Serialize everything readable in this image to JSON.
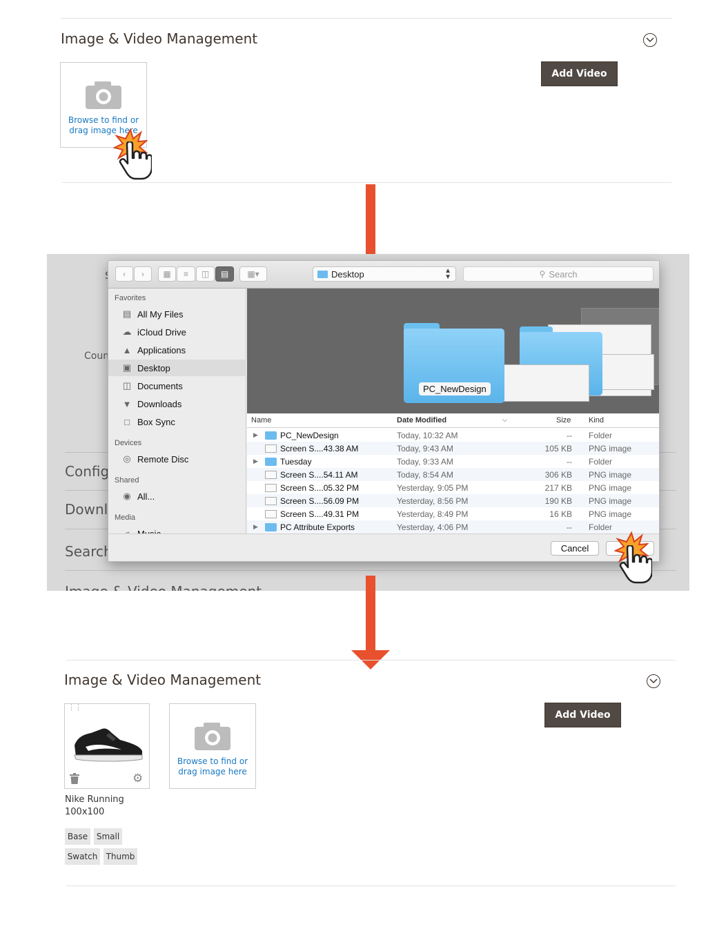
{
  "top_panel": {
    "title": "Image & Video Management",
    "add_video_label": "Add Video",
    "browse_text_1": "Browse to find or",
    "browse_text_2": "drag image here"
  },
  "file_dialog": {
    "location": "Desktop",
    "search_placeholder": "Search",
    "background_labels": [
      "S",
      "Coun",
      "Config",
      "Downl",
      "Search",
      "Image & Video Management"
    ],
    "sidebar": {
      "favorites_header": "Favorites",
      "favorites": [
        "All My Files",
        "iCloud Drive",
        "Applications",
        "Desktop",
        "Documents",
        "Downloads",
        "Box Sync"
      ],
      "devices_header": "Devices",
      "devices": [
        "Remote Disc"
      ],
      "shared_header": "Shared",
      "shared": [
        "All..."
      ],
      "media_header": "Media",
      "media": [
        "Music"
      ]
    },
    "preview_folder_label": "PC_NewDesign",
    "columns": {
      "name": "Name",
      "date": "Date Modified",
      "size": "Size",
      "kind": "Kind"
    },
    "files": [
      {
        "name": "PC_NewDesign",
        "date": "Today, 10:32 AM",
        "size": "--",
        "kind": "Folder",
        "type": "folder"
      },
      {
        "name": "Screen S....43.38 AM",
        "date": "Today, 9:43 AM",
        "size": "105 KB",
        "kind": "PNG image",
        "type": "png"
      },
      {
        "name": "Tuesday",
        "date": "Today, 9:33 AM",
        "size": "--",
        "kind": "Folder",
        "type": "folder"
      },
      {
        "name": "Screen S....54.11 AM",
        "date": "Today, 8:54 AM",
        "size": "306 KB",
        "kind": "PNG image",
        "type": "png"
      },
      {
        "name": "Screen S....05.32 PM",
        "date": "Yesterday, 9:05 PM",
        "size": "217 KB",
        "kind": "PNG image",
        "type": "png"
      },
      {
        "name": "Screen S....56.09 PM",
        "date": "Yesterday, 8:56 PM",
        "size": "190 KB",
        "kind": "PNG image",
        "type": "png"
      },
      {
        "name": "Screen S....49.31 PM",
        "date": "Yesterday, 8:49 PM",
        "size": "16 KB",
        "kind": "PNG image",
        "type": "png"
      },
      {
        "name": "PC Attribute Exports",
        "date": "Yesterday, 4:06 PM",
        "size": "--",
        "kind": "Folder",
        "type": "folder"
      }
    ],
    "cancel_label": "Cancel"
  },
  "bottom_panel": {
    "title": "Image & Video Management",
    "add_video_label": "Add Video",
    "image_name": "Nike Running",
    "image_size": "100x100",
    "roles": [
      "Base",
      "Small",
      "Swatch",
      "Thumb"
    ],
    "browse_text_1": "Browse to find or",
    "browse_text_2": "drag image here"
  },
  "colors": {
    "accent_arrow": "#e8512e",
    "button_dark": "#514943",
    "link_blue": "#1979c3"
  }
}
